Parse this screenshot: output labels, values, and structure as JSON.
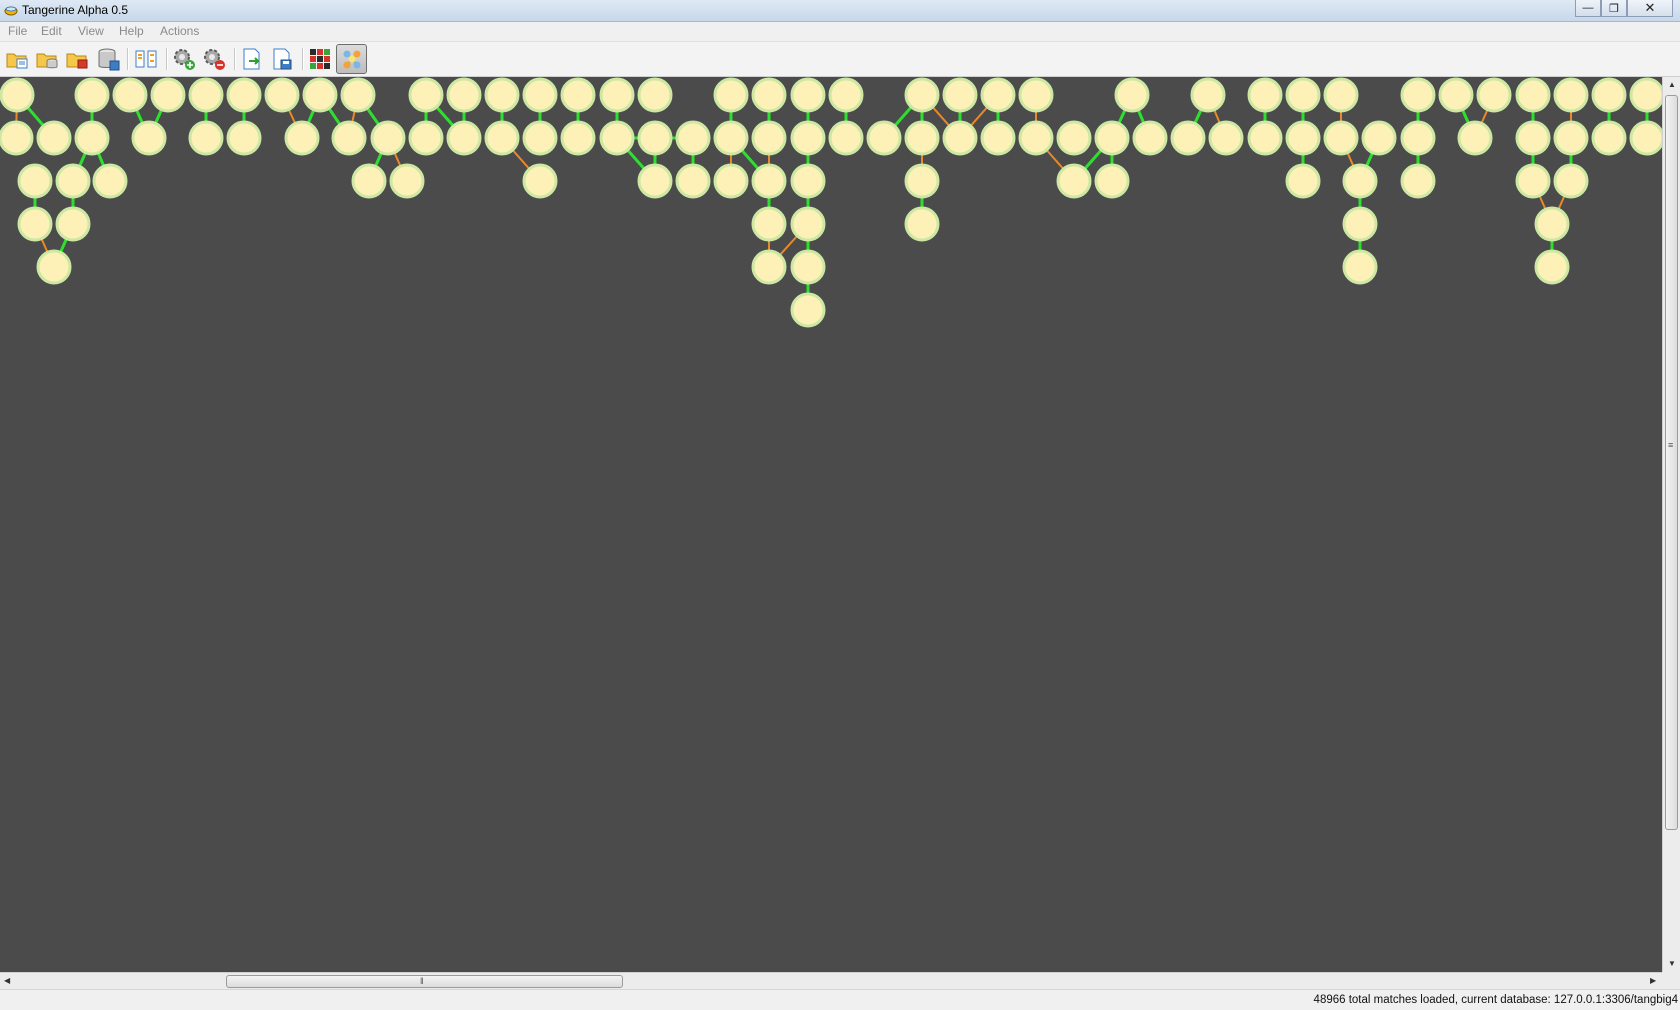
{
  "window": {
    "title": "Tangerine Alpha 0.5"
  },
  "menu": [
    "File",
    "Edit",
    "View",
    "Help",
    "Actions"
  ],
  "toolbar": {
    "buttons": [
      {
        "name": "open-folder-button",
        "icon": "open-folder-icon"
      },
      {
        "name": "open-database-folder-button",
        "icon": "folder-database-icon"
      },
      {
        "name": "close-folder-button",
        "icon": "folder-close-icon"
      },
      {
        "name": "save-database-button",
        "icon": "database-save-icon"
      },
      {
        "name": "layout-columns-button",
        "icon": "columns-icon"
      },
      {
        "name": "add-settings-button",
        "icon": "gear-add-icon"
      },
      {
        "name": "remove-settings-button",
        "icon": "gear-remove-icon"
      },
      {
        "name": "export-button",
        "icon": "export-document-icon"
      },
      {
        "name": "save-document-button",
        "icon": "document-save-icon"
      },
      {
        "name": "color-grid-button",
        "icon": "color-grid-icon"
      },
      {
        "name": "graph-view-button",
        "icon": "graph-nodes-icon",
        "active": true
      }
    ]
  },
  "graph": {
    "background": "#4b4b4b",
    "node_fill": "#fdf1b8",
    "node_ring": "#cde8a3",
    "edge_colors": {
      "green": "#2ee02e",
      "orange": "#e88a2a"
    },
    "node_count": 108
  },
  "status": {
    "text": "48966 total matches loaded, current database: 127.0.0.1:3306/tangbig4"
  }
}
